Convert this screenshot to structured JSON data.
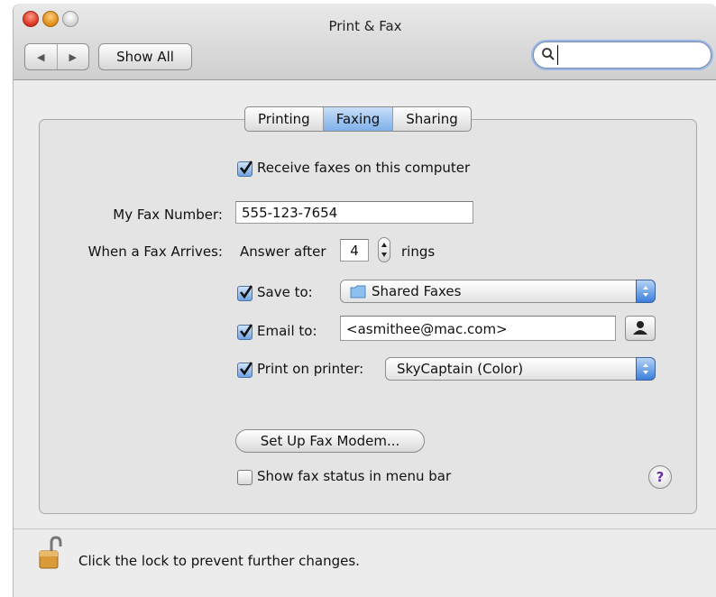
{
  "window": {
    "title": "Print & Fax",
    "nav_back": "◀",
    "nav_forward": "▶",
    "show_all_label": "Show All",
    "search": {
      "value": "",
      "placeholder": ""
    }
  },
  "tabs": [
    {
      "label": "Printing",
      "active": false
    },
    {
      "label": "Faxing",
      "active": true
    },
    {
      "label": "Sharing",
      "active": false
    }
  ],
  "faxing": {
    "receive_checkbox": {
      "label": "Receive faxes on this computer",
      "checked": true
    },
    "fax_number_label": "My Fax Number:",
    "fax_number_value": "555-123-7654",
    "arrives_label": "When a Fax Arrives:",
    "answer_after_label": "Answer after",
    "rings_value": "4",
    "rings_label": "rings",
    "save_to": {
      "label": "Save to:",
      "checked": true,
      "value": "Shared Faxes"
    },
    "email_to": {
      "label": "Email to:",
      "checked": true,
      "value": "<asmithee@mac.com>"
    },
    "print_on": {
      "label": "Print on printer:",
      "checked": true,
      "value": "SkyCaptain (Color)"
    },
    "setup_modem_label": "Set Up Fax Modem...",
    "status_checkbox": {
      "label": "Show fax status in menu bar",
      "checked": false
    },
    "help_label": "?"
  },
  "footer": {
    "lock_text": "Click the lock to prevent further changes."
  },
  "colors": {
    "selection_blue": "#7fb0ea",
    "help_purple": "#6a2fa8"
  }
}
